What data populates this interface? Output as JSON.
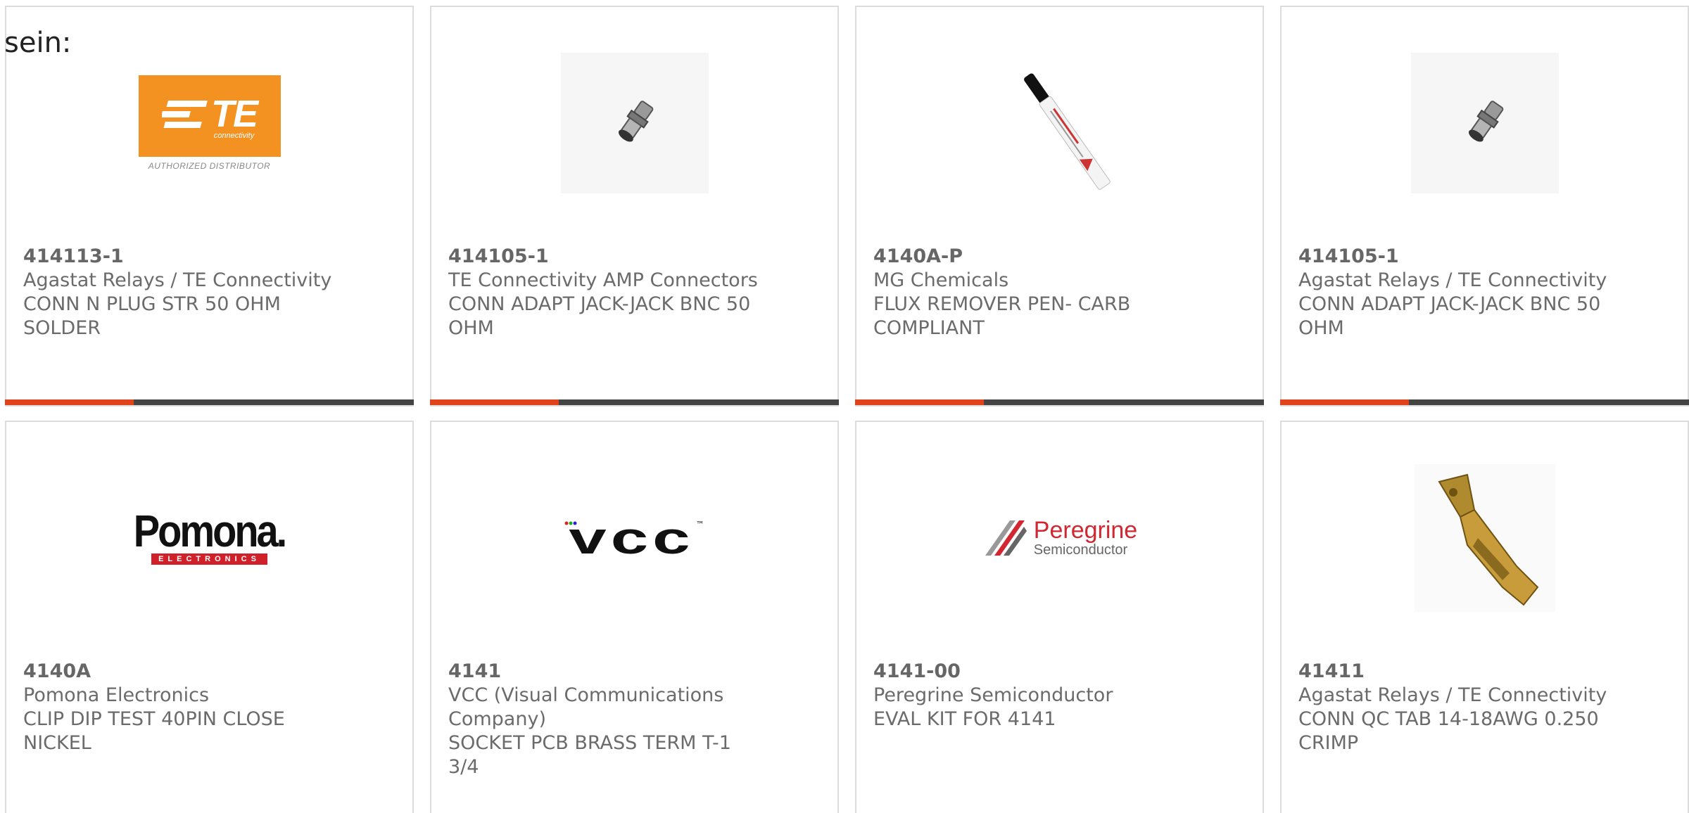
{
  "heading_fragment": "sein:",
  "products": [
    {
      "part": "414113-1",
      "manufacturer": "Agastat Relays / TE Connectivity",
      "description": "CONN N PLUG STR 50 OHM SOLDER",
      "image": "te-logo",
      "image_brand": "TE",
      "image_sub": "connectivity",
      "image_caption": "AUTHORIZED DISTRIBUTOR"
    },
    {
      "part": "414105-1",
      "manufacturer": "TE Connectivity AMP Connectors",
      "description": "CONN ADAPT JACK-JACK BNC 50 OHM",
      "image": "bnc-adapter-photo"
    },
    {
      "part": "4140A-P",
      "manufacturer": "MG Chemicals",
      "description": "FLUX REMOVER PEN- CARB COMPLIANT",
      "image": "flux-pen-photo"
    },
    {
      "part": "414105-1",
      "manufacturer": "Agastat Relays / TE Connectivity",
      "description": "CONN ADAPT JACK-JACK BNC 50 OHM",
      "image": "bnc-adapter-photo"
    },
    {
      "part": "4140A",
      "manufacturer": "Pomona Electronics",
      "description": "CLIP DIP TEST 40PIN CLOSE NICKEL",
      "image": "pomona-logo",
      "image_brand": "Pomona.",
      "image_sub": "ELECTRONICS"
    },
    {
      "part": "4141",
      "manufacturer": "VCC (Visual Communications Company)",
      "description": "SOCKET PCB BRASS TERM T-1 3/4",
      "image": "vcc-logo",
      "image_brand": "vcc",
      "image_mark": "™"
    },
    {
      "part": "4141-00",
      "manufacturer": "Peregrine Semiconductor",
      "description": "EVAL KIT FOR 4141",
      "image": "peregrine-logo",
      "image_brand": "Peregrine",
      "image_sub": "Semiconductor"
    },
    {
      "part": "41411",
      "manufacturer": "Agastat Relays / TE Connectivity",
      "description": "CONN QC TAB 14-18AWG 0.250 CRIMP",
      "image": "brass-tab-photo"
    }
  ],
  "colors": {
    "accent_red": "#e0421a",
    "accent_dark": "#444444",
    "te_orange": "#f39121",
    "pomona_red": "#d0202a",
    "peregrine_red": "#d22630"
  }
}
